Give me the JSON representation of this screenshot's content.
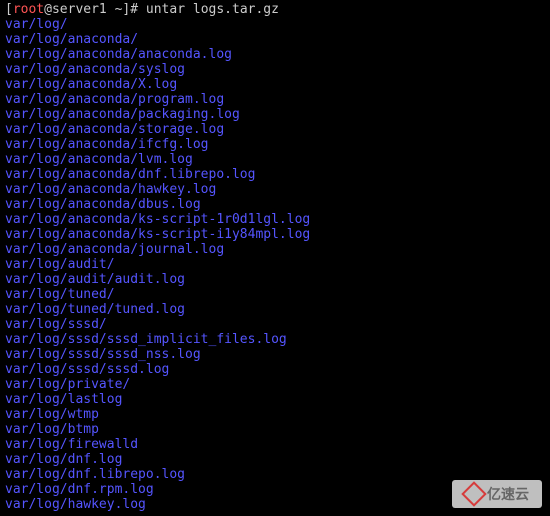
{
  "prompt": {
    "open_bracket": "[",
    "user": "root",
    "at": "@",
    "host": "server1",
    "space": " ",
    "tilde": "~",
    "close_bracket": "]",
    "hash": "# "
  },
  "command": "untar logs.tar.gz",
  "output_lines": [
    "var/log/",
    "var/log/anaconda/",
    "var/log/anaconda/anaconda.log",
    "var/log/anaconda/syslog",
    "var/log/anaconda/X.log",
    "var/log/anaconda/program.log",
    "var/log/anaconda/packaging.log",
    "var/log/anaconda/storage.log",
    "var/log/anaconda/ifcfg.log",
    "var/log/anaconda/lvm.log",
    "var/log/anaconda/dnf.librepo.log",
    "var/log/anaconda/hawkey.log",
    "var/log/anaconda/dbus.log",
    "var/log/anaconda/ks-script-1r0d1lgl.log",
    "var/log/anaconda/ks-script-i1y84mpl.log",
    "var/log/anaconda/journal.log",
    "var/log/audit/",
    "var/log/audit/audit.log",
    "var/log/tuned/",
    "var/log/tuned/tuned.log",
    "var/log/sssd/",
    "var/log/sssd/sssd_implicit_files.log",
    "var/log/sssd/sssd_nss.log",
    "var/log/sssd/sssd.log",
    "var/log/private/",
    "var/log/lastlog",
    "var/log/wtmp",
    "var/log/btmp",
    "var/log/firewalld",
    "var/log/dnf.log",
    "var/log/dnf.librepo.log",
    "var/log/dnf.rpm.log",
    "var/log/hawkey.log"
  ],
  "watermark": {
    "text": "亿速云"
  }
}
